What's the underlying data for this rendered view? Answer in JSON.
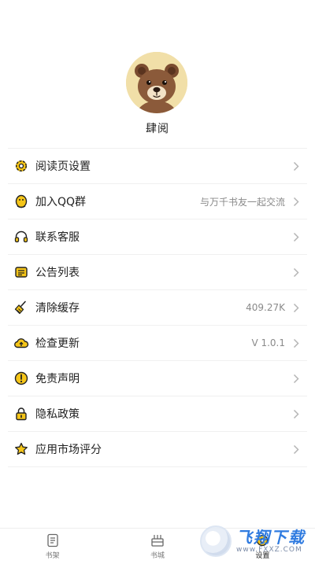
{
  "profile": {
    "name": "肆阅"
  },
  "menu": [
    {
      "icon": "gear-icon",
      "label": "阅读页设置",
      "value": ""
    },
    {
      "icon": "qq-penguin-icon",
      "label": "加入QQ群",
      "value": "与万千书友一起交流"
    },
    {
      "icon": "headset-icon",
      "label": "联系客服",
      "value": ""
    },
    {
      "icon": "list-icon",
      "label": "公告列表",
      "value": ""
    },
    {
      "icon": "broom-icon",
      "label": "清除缓存",
      "value": "409.27K"
    },
    {
      "icon": "cloud-upload-icon",
      "label": "检查更新",
      "value": "V 1.0.1"
    },
    {
      "icon": "exclamation-circle-icon",
      "label": "免责声明",
      "value": ""
    },
    {
      "icon": "lock-icon",
      "label": "隐私政策",
      "value": ""
    },
    {
      "icon": "star-icon",
      "label": "应用市场评分",
      "value": ""
    }
  ],
  "tabs": [
    {
      "icon": "bookshelf-icon",
      "label": "书架"
    },
    {
      "icon": "bookstore-icon",
      "label": "书城"
    },
    {
      "icon": "settings-icon",
      "label": "设置"
    }
  ],
  "watermark": {
    "brand": "飞翔下载",
    "url": "www.FXXZ.COM"
  },
  "colors": {
    "icon_yellow": "#f5c518",
    "icon_stroke": "#222222",
    "chevron": "#b5b5b5",
    "value_gray": "#8a8a8a"
  }
}
